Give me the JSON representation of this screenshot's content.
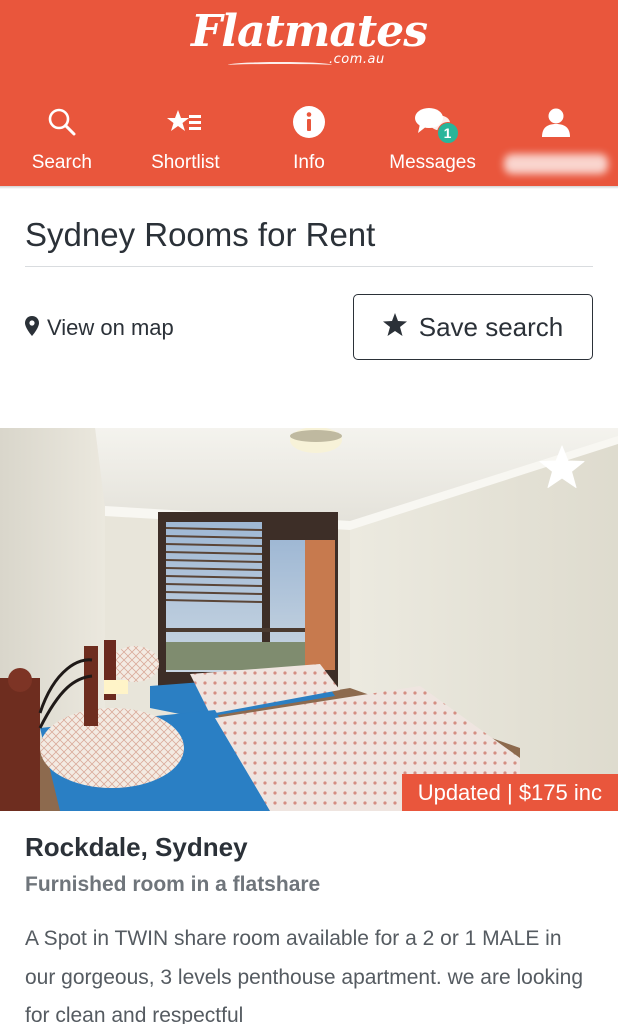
{
  "brand": {
    "logo_text": "Flatmates",
    "logo_domain": ".com.au",
    "brand_color": "#e9563c"
  },
  "nav": {
    "items": [
      {
        "label": "Search",
        "icon": "search-icon"
      },
      {
        "label": "Shortlist",
        "icon": "shortlist-star-icon"
      },
      {
        "label": "Info",
        "icon": "info-icon"
      },
      {
        "label": "Messages",
        "icon": "chat-bubbles-icon",
        "badge": "1"
      },
      {
        "label": "",
        "icon": "user-icon",
        "blurred": true
      }
    ],
    "badge_color": "#29b59a"
  },
  "page": {
    "title": "Sydney Rooms for Rent"
  },
  "actions": {
    "map_label": "View on map",
    "map_icon": "map-pin-icon",
    "save_label": "Save search",
    "save_icon": "star-icon"
  },
  "listing": {
    "image_alt": "Bedroom with twin beds",
    "favourite_icon": "star-outline-icon",
    "price_tag": "Updated | $175 inc",
    "location": "Rockdale, Sydney",
    "type": "Furnished room in a flatshare",
    "description": "A Spot in TWIN share room available for a 2 or 1 MALE in our gorgeous, 3 levels penthouse apartment. we are looking for clean and respectful"
  }
}
